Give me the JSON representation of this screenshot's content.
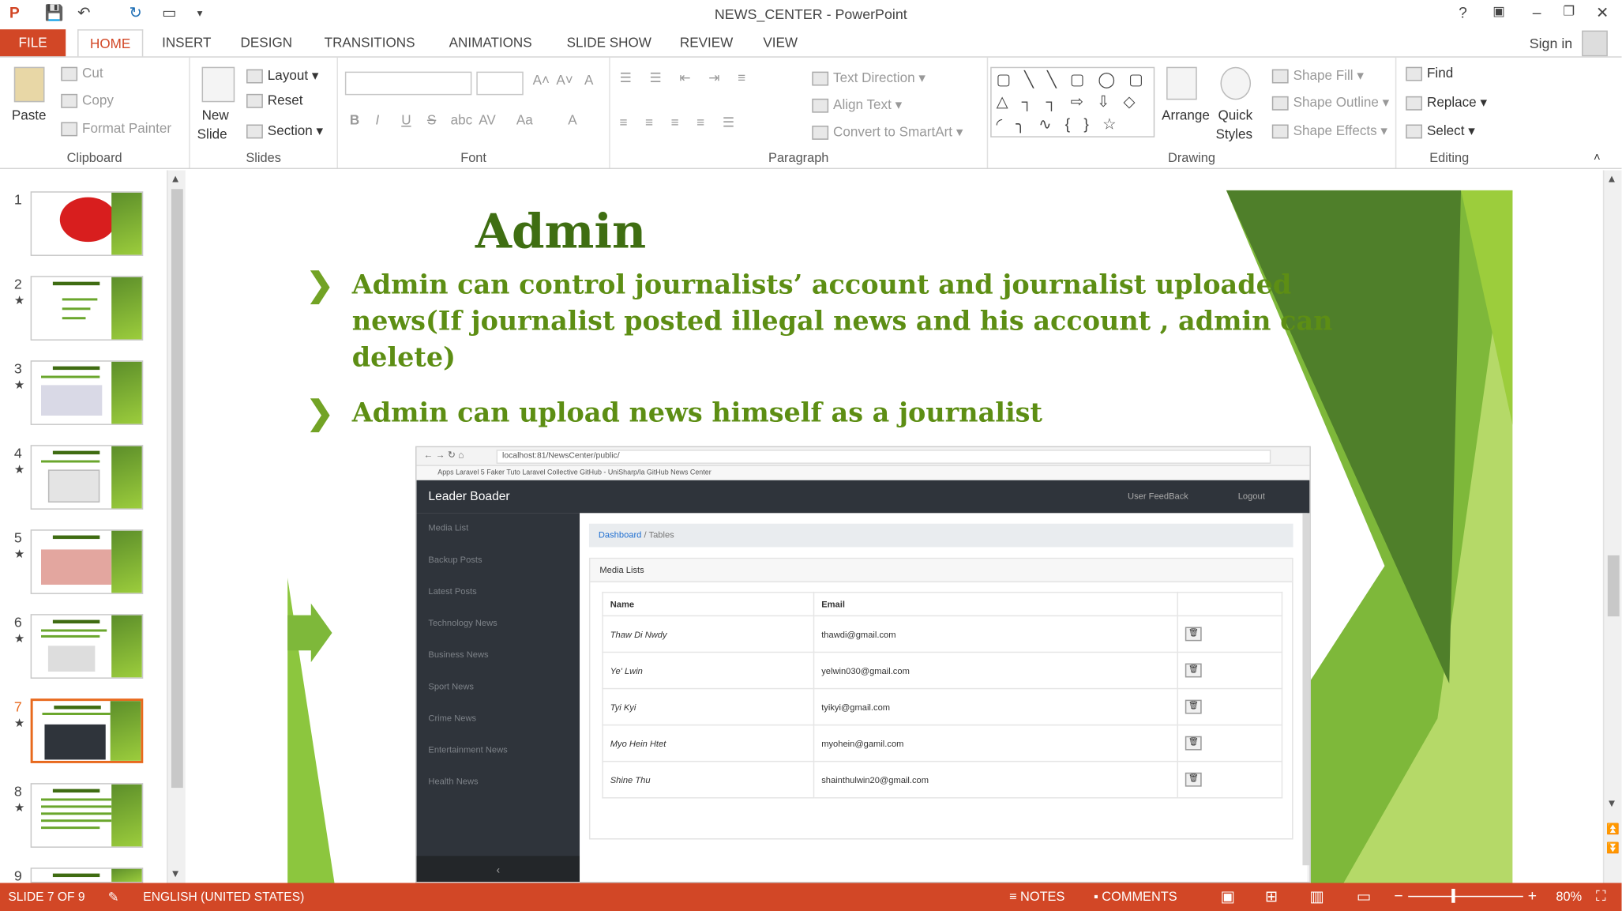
{
  "window": {
    "title": "NEWS_CENTER - PowerPoint",
    "help": "?",
    "min": "–",
    "restore": "❐",
    "close": "✕"
  },
  "quick_access": {
    "app_icon": "P",
    "save": "💾",
    "undo": "↶",
    "redo": "↻",
    "present": "▭",
    "more": "▾"
  },
  "tabs": [
    "FILE",
    "HOME",
    "INSERT",
    "DESIGN",
    "TRANSITIONS",
    "ANIMATIONS",
    "SLIDE SHOW",
    "REVIEW",
    "VIEW"
  ],
  "active_tab": "HOME",
  "account": {
    "sign_in": "Sign in"
  },
  "ribbon": {
    "clipboard": {
      "paste": "Paste",
      "cut": "Cut",
      "copy": "Copy",
      "format_painter": "Format Painter",
      "label": "Clipboard"
    },
    "slides": {
      "new_slide": "New",
      "new_slide2": "Slide",
      "layout": "Layout",
      "reset": "Reset",
      "section": "Section",
      "label": "Slides"
    },
    "font": {
      "bold": "B",
      "italic": "I",
      "underline": "U",
      "strike": "S",
      "shadow": "abc",
      "spacing": "AV",
      "case": "Aa",
      "color": "A",
      "grow": "A˄",
      "shrink": "A˅",
      "clear": "A",
      "label": "Font"
    },
    "paragraph": {
      "text_direction": "Text Direction",
      "align_text": "Align Text",
      "convert_smartart": "Convert to SmartArt",
      "label": "Paragraph"
    },
    "drawing": {
      "shapes": "▢ ╲ ╲ ▢ ◯ ▢ △ ┐ ┐ ⇨ ⇩ ◇ ◜ ╮ ∿ { } ☆",
      "arrange": "Arrange",
      "quick_styles": "Quick",
      "quick_styles2": "Styles",
      "shape_fill": "Shape Fill",
      "shape_outline": "Shape Outline",
      "shape_effects": "Shape Effects",
      "label": "Drawing"
    },
    "editing": {
      "find": "Find",
      "replace": "Replace",
      "select": "Select",
      "label": "Editing"
    }
  },
  "thumbnails": [
    {
      "num": "1",
      "star": ""
    },
    {
      "num": "2",
      "star": "★"
    },
    {
      "num": "3",
      "star": "★"
    },
    {
      "num": "4",
      "star": "★"
    },
    {
      "num": "5",
      "star": "★"
    },
    {
      "num": "6",
      "star": "★"
    },
    {
      "num": "7",
      "star": "★"
    },
    {
      "num": "8",
      "star": "★"
    },
    {
      "num": "9",
      "star": ""
    }
  ],
  "selected_slide": 7,
  "slide": {
    "title": "Admin",
    "bullet1": "Admin can control journalists’ account and journalist uploaded news(If journalist posted illegal news and his account , admin can delete)",
    "bullet2": "Admin can upload news himself as a journalist"
  },
  "embedded_app": {
    "url": "localhost:81/NewsCenter/public/",
    "bookmarks": "Apps   Laravel 5 Faker Tuto   Laravel Collective   GitHub - UniSharp/la   GitHub   News Center",
    "brand": "Leader Boader",
    "nav_right": [
      "User FeedBack",
      "Logout"
    ],
    "sidebar": [
      "Media List",
      "Backup Posts",
      "Latest Posts",
      "Technology News",
      "Business News",
      "Sport News",
      "Crime News",
      "Entertainment News",
      "Health News"
    ],
    "collapse": "‹",
    "breadcrumb": {
      "root": "Dashboard",
      "sep": "/",
      "current": "Tables"
    },
    "card_title": "Media Lists",
    "columns": [
      "Name",
      "Email",
      ""
    ],
    "rows": [
      {
        "name": "Thaw Di Nwdy",
        "email": "thawdi@gmail.com"
      },
      {
        "name": "Ye' Lwin",
        "email": "yelwin030@gmail.com"
      },
      {
        "name": "Tyi Kyi",
        "email": "tyikyi@gmail.com"
      },
      {
        "name": "Myo Hein Htet",
        "email": "myohein@gamil.com"
      },
      {
        "name": "Shine Thu",
        "email": "shainthulwin20@gmail.com"
      }
    ]
  },
  "status": {
    "slide_info": "SLIDE 7 OF 9",
    "language": "ENGLISH (UNITED STATES)",
    "notes": "NOTES",
    "comments": "COMMENTS",
    "zoom": "80%",
    "zoom_fraction": 0.4
  },
  "colors": {
    "accent": "#d24726",
    "slide_title": "#3f6e12",
    "slide_text": "#5d8e14",
    "selection": "#e8691d"
  }
}
